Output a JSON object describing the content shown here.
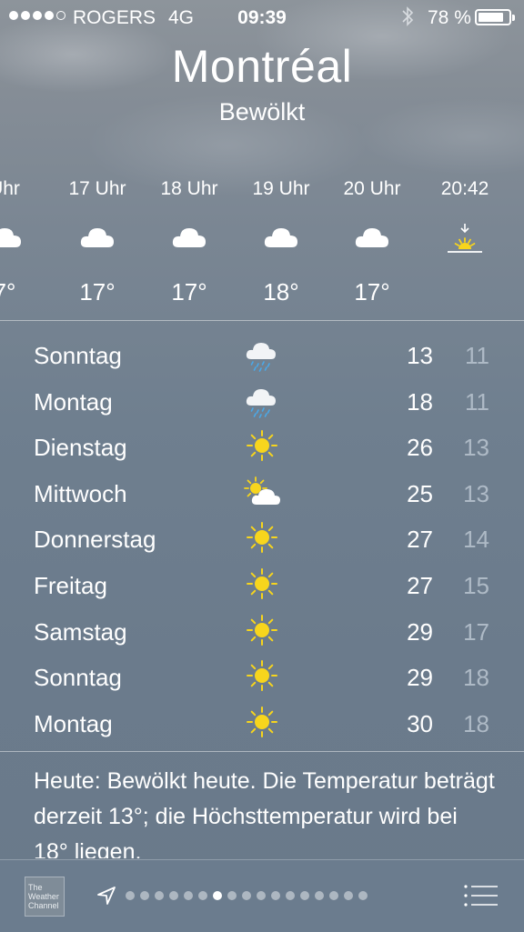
{
  "status": {
    "carrier": "ROGERS",
    "network": "4G",
    "time": "09:39",
    "battery_pct": "78 %",
    "signal_bars_filled": 4,
    "signal_bars_total": 5,
    "battery_level": 0.78
  },
  "header": {
    "city": "Montréal",
    "condition": "Bewölkt"
  },
  "hourly": [
    {
      "time": "Uhr",
      "icon": "cloud-icon",
      "temp": "7°"
    },
    {
      "time": "17 Uhr",
      "icon": "cloud-icon",
      "temp": "17°"
    },
    {
      "time": "18 Uhr",
      "icon": "cloud-icon",
      "temp": "17°"
    },
    {
      "time": "19 Uhr",
      "icon": "cloud-icon",
      "temp": "18°"
    },
    {
      "time": "20 Uhr",
      "icon": "cloud-icon",
      "temp": "17°"
    },
    {
      "time": "20:42",
      "icon": "sunset-icon",
      "temp": ""
    }
  ],
  "daily": [
    {
      "day": "Sonntag",
      "icon": "rain-icon",
      "high": "13",
      "low": "11"
    },
    {
      "day": "Montag",
      "icon": "rain-icon",
      "high": "18",
      "low": "11"
    },
    {
      "day": "Dienstag",
      "icon": "sun-icon",
      "high": "26",
      "low": "13"
    },
    {
      "day": "Mittwoch",
      "icon": "partly-cloudy-icon",
      "high": "25",
      "low": "13"
    },
    {
      "day": "Donnerstag",
      "icon": "sun-icon",
      "high": "27",
      "low": "14"
    },
    {
      "day": "Freitag",
      "icon": "sun-icon",
      "high": "27",
      "low": "15"
    },
    {
      "day": "Samstag",
      "icon": "sun-icon",
      "high": "29",
      "low": "17"
    },
    {
      "day": "Sonntag",
      "icon": "sun-icon",
      "high": "29",
      "low": "18"
    },
    {
      "day": "Montag",
      "icon": "sun-icon",
      "high": "30",
      "low": "18"
    }
  ],
  "summary": "Heute: Bewölkt heute. Die Temperatur beträgt derzeit 13°; die Höchsttemperatur wird bei 18° liegen.",
  "toolbar": {
    "logo_text": "The Weather Channel",
    "page_count": 17,
    "active_page_index": 6
  },
  "colors": {
    "sun": "#f7d51d",
    "rain": "#4aa8e8",
    "low_temp": "#aebac6"
  }
}
